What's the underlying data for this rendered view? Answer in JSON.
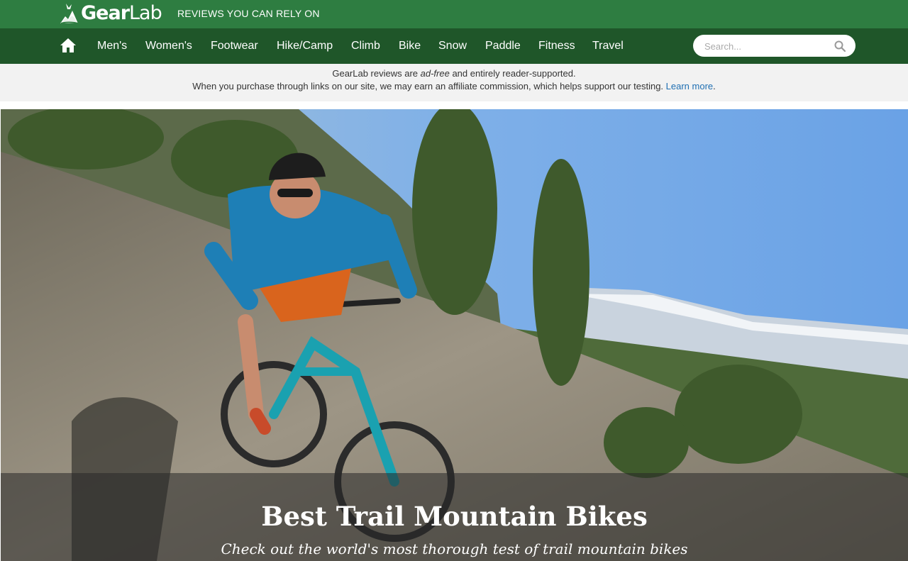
{
  "header": {
    "logo_text_gear": "Gear",
    "logo_text_lab": "Lab",
    "tagline": "REVIEWS YOU CAN RELY ON"
  },
  "nav": {
    "home_icon": "home-icon",
    "items": [
      "Men's",
      "Women's",
      "Footwear",
      "Hike/Camp",
      "Climb",
      "Bike",
      "Snow",
      "Paddle",
      "Fitness",
      "Travel"
    ],
    "search_placeholder": "Search...",
    "search_icon": "search-icon"
  },
  "notice": {
    "line1_prefix": "GearLab reviews are ",
    "line1_emphasis": "ad-free",
    "line1_suffix": " and entirely reader-supported.",
    "line2_text": "When you purchase through links on our site, we may earn an affiliate commission, which helps support our testing. ",
    "line2_link": "Learn more",
    "line2_end": "."
  },
  "hero": {
    "title": "Best Trail Mountain Bikes",
    "subtitle": "Check out the world's most thorough test of trail mountain bikes"
  },
  "colors": {
    "topbar": "#2e7d41",
    "navbar": "#1f5629",
    "notice_bg": "#f2f2f2",
    "link": "#1f6fb2"
  }
}
